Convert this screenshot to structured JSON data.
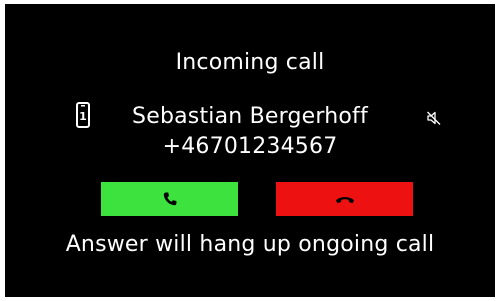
{
  "screen": {
    "title": "Incoming call",
    "caller": {
      "name": "Sebastian Bergerhoff",
      "number": "+46701234567",
      "line_icon": "phone-line-1-icon",
      "line_number": "1",
      "ringer_icon": "speaker-muted-icon"
    },
    "buttons": {
      "answer": {
        "icon": "phone-answer-icon",
        "color": "#3ee23e"
      },
      "decline": {
        "icon": "phone-hangup-icon",
        "color": "#ee1111"
      }
    },
    "note": "Answer will hang up ongoing call"
  },
  "colors": {
    "background": "#000000",
    "text": "#ffffff"
  }
}
